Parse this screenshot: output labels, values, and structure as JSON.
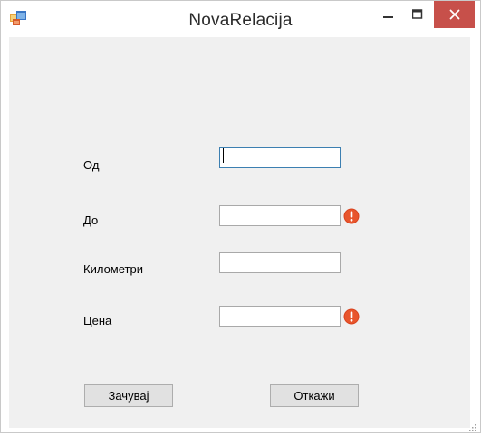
{
  "window": {
    "title": "NovaRelacija",
    "controls": {
      "minimize": "minimize",
      "maximize": "maximize",
      "close": "close"
    }
  },
  "form": {
    "fields": [
      {
        "label": "Од",
        "value": "",
        "focused": true,
        "error": false
      },
      {
        "label": "До",
        "value": "",
        "focused": false,
        "error": true
      },
      {
        "label": "Километри",
        "value": "",
        "focused": false,
        "error": false
      },
      {
        "label": "Цена",
        "value": "",
        "focused": false,
        "error": true
      }
    ],
    "buttons": {
      "save_label": "Зачувај",
      "cancel_label": "Откажи"
    }
  },
  "icons": {
    "app": "app-window-icon",
    "error": "error-exclamation-icon",
    "grip": "size-grip-icon"
  },
  "colors": {
    "client_background": "#f0f0f0",
    "close_button": "#c7504a",
    "focus_border": "#3c7fb1",
    "error_icon": "#d9431e"
  }
}
